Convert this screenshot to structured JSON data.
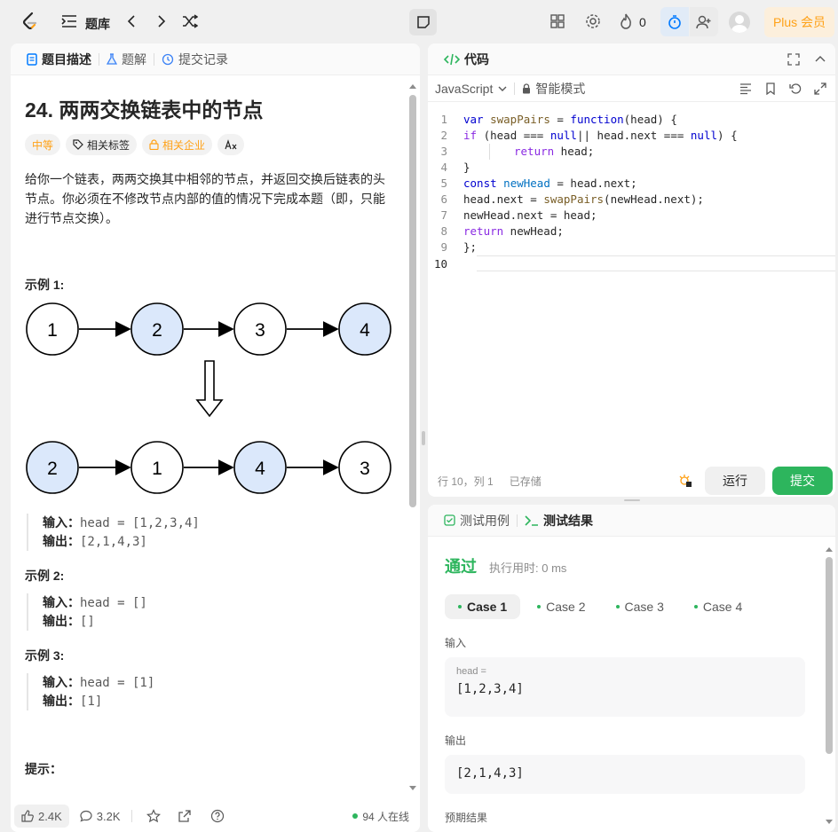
{
  "topbar": {
    "problem_list": "题库",
    "streak": "0",
    "plus": "Plus 会员"
  },
  "left": {
    "tabs": [
      "题目描述",
      "题解",
      "提交记录"
    ],
    "title": "24. 两两交换链表中的节点",
    "difficulty": "中等",
    "tags": [
      "相关标签",
      "相关企业"
    ],
    "description": "给你一个链表，两两交换其中相邻的节点，并返回交换后链表的头节点。你必须在不修改节点内部的值的情况下完成本题（即，只能进行节点交换）。",
    "example1_title": "示例 1:",
    "diagram_top": [
      "1",
      "2",
      "3",
      "4"
    ],
    "diagram_bottom": [
      "2",
      "1",
      "4",
      "3"
    ],
    "ex1_input_label": "输入：",
    "ex1_input": "head = [1,2,3,4]",
    "ex1_output_label": "输出：",
    "ex1_output": "[2,1,4,3]",
    "example2_title": "示例 2:",
    "ex2_input_label": "输入：",
    "ex2_input": "head = []",
    "ex2_output_label": "输出：",
    "ex2_output": "[]",
    "example3_title": "示例 3:",
    "ex3_input_label": "输入：",
    "ex3_input": "head = [1]",
    "ex3_output_label": "输出：",
    "ex3_output": "[1]",
    "hint_title": "提示：",
    "likes": "2.4K",
    "comments": "3.2K",
    "online": "94 人在线"
  },
  "code": {
    "tab": "代码",
    "language": "JavaScript",
    "mode": "智能模式",
    "status": "行 10，列 1",
    "saved": "已存储",
    "run": "运行",
    "submit": "提交",
    "lines": [
      "var swapPairs = function(head) {",
      "    if (head === null|| head.next === null) {",
      "        return head;",
      "    }",
      "    const newHead = head.next;",
      "    head.next = swapPairs(newHead.next);",
      "    newHead.next = head;",
      "    return newHead;",
      "};",
      ""
    ]
  },
  "result": {
    "tabs": [
      "测试用例",
      "测试结果"
    ],
    "status": "通过",
    "runtime": "执行用时: 0 ms",
    "cases": [
      "Case 1",
      "Case 2",
      "Case 3",
      "Case 4"
    ],
    "input_label": "输入",
    "var_name": "head =",
    "input_value": "[1,2,3,4]",
    "output_label": "输出",
    "output_value": "[2,1,4,3]",
    "expected_label": "预期结果"
  },
  "colors": {
    "accent": "#007aff",
    "green": "#2db55d",
    "orange": "#ffa116",
    "node_fill": "#dbe8fb"
  }
}
